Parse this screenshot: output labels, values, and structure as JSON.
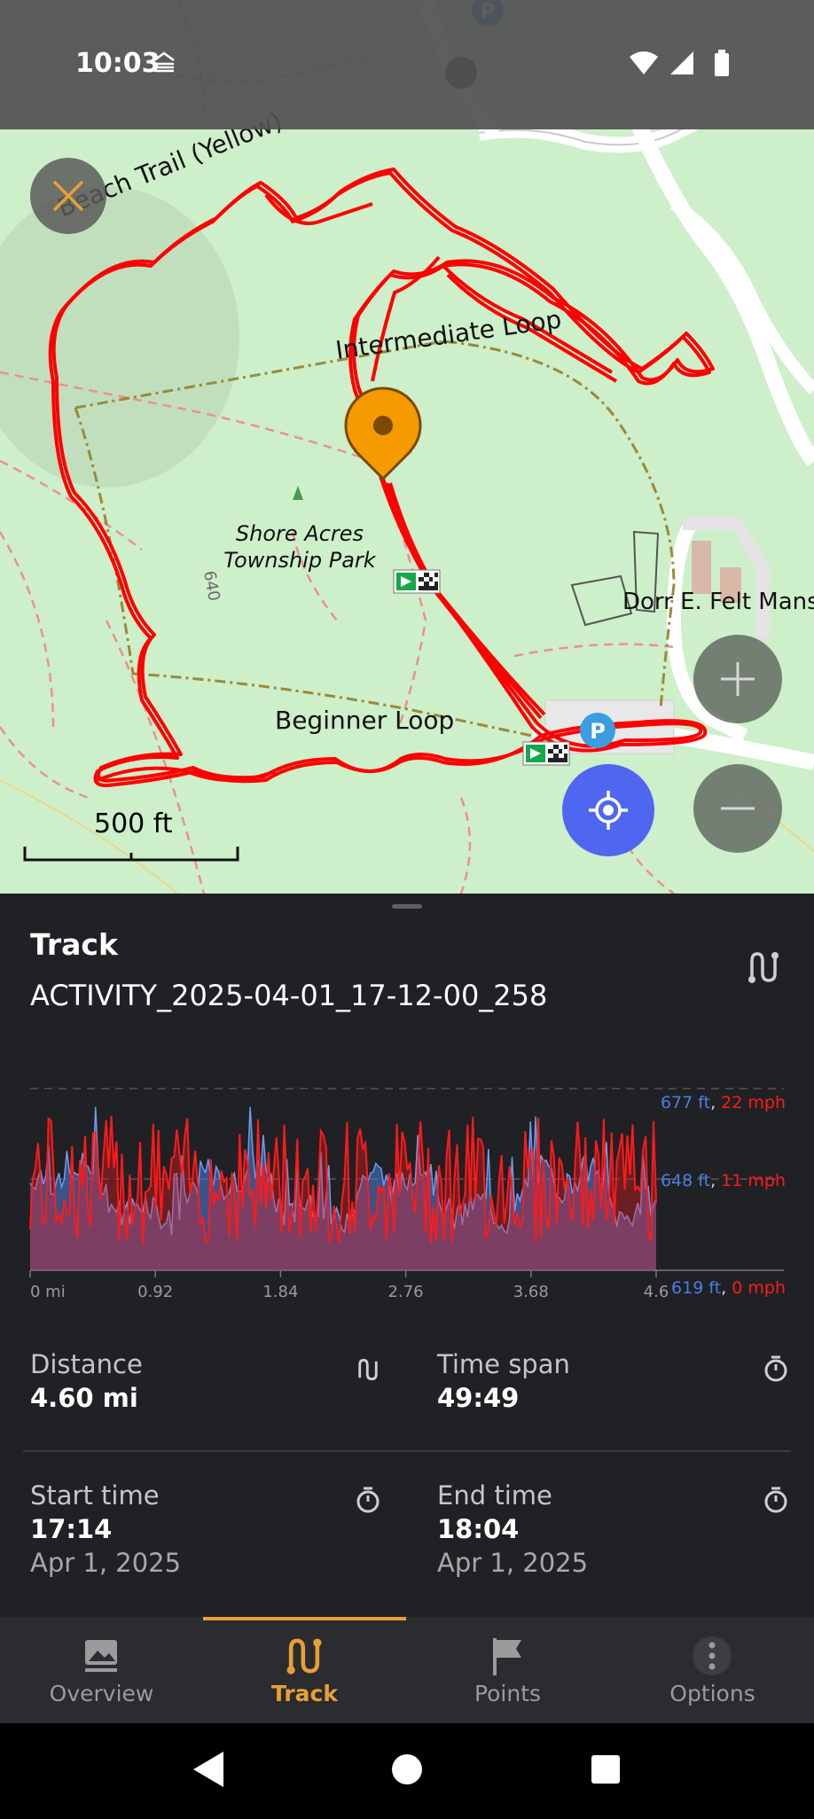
{
  "status_bar": {
    "time": "10:03"
  },
  "map": {
    "labels": {
      "beach_trail": "Beach Trail (Yellow)",
      "intermediate_loop": "Intermediate Loop",
      "park_line1": "Shore Acres",
      "park_line2": "Township Park",
      "elevation": "640",
      "beginner_loop": "Beginner Loop",
      "mansion": "Dorr E. Felt Mansion"
    },
    "scale_label": "500 ft"
  },
  "sheet": {
    "title": "Track",
    "track_name": "ACTIVITY_2025-04-01_17-12-00_258"
  },
  "chart_data": {
    "type": "area",
    "x_ticks": [
      "0 mi",
      "0.92",
      "1.84",
      "2.76",
      "3.68",
      "4.6"
    ],
    "y_labels": [
      {
        "elevation": "677 ft",
        "speed": "22 mph"
      },
      {
        "elevation": "648 ft",
        "speed": "11 mph"
      },
      {
        "elevation": "619 ft",
        "speed": "0 mph"
      }
    ],
    "series": [
      {
        "name": "Elevation",
        "color": "#4a7fe0"
      },
      {
        "name": "Speed",
        "color": "#ff1a1a"
      }
    ],
    "xlim": [
      0,
      4.6
    ],
    "elevation_ylim": [
      619,
      677
    ],
    "speed_ylim": [
      0,
      22
    ]
  },
  "stats": {
    "distance": {
      "label": "Distance",
      "value": "4.60 mi"
    },
    "time_span": {
      "label": "Time span",
      "value": "49:49"
    },
    "start_time": {
      "label": "Start time",
      "value": "17:14",
      "date": "Apr 1, 2025"
    },
    "end_time": {
      "label": "End time",
      "value": "18:04",
      "date": "Apr 1, 2025"
    }
  },
  "nav": {
    "overview": "Overview",
    "track": "Track",
    "points": "Points",
    "options": "Options"
  },
  "colors": {
    "accent": "#e8a034",
    "track": "#ff0000",
    "locate": "#4f67f0",
    "elevation": "#4a7fe0",
    "speed": "#ff1a1a"
  }
}
